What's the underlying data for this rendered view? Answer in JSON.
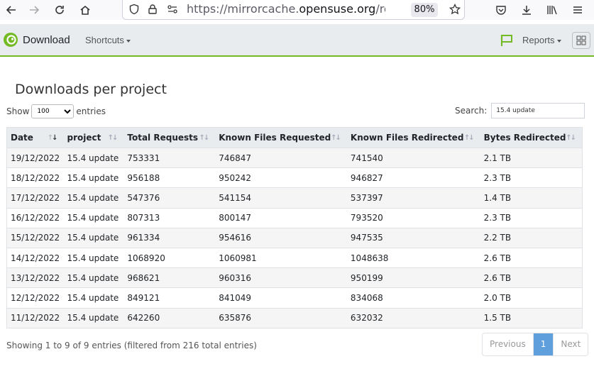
{
  "browser": {
    "url_prefix": "https://mirrorcache.",
    "url_domain": "opensuse.org",
    "url_suffix": "/report/dow",
    "zoom": "80%"
  },
  "header": {
    "brand": "Download",
    "shortcuts": "Shortcuts",
    "reports": "Reports"
  },
  "page": {
    "title": "Downloads per project",
    "show_label": "Show",
    "entries_label": "entries",
    "page_length": "100",
    "search_label": "Search:",
    "search_value": "15.4 update"
  },
  "table": {
    "columns": [
      "Date",
      "project",
      "Total Requests",
      "Known Files Requested",
      "Known Files Redirected",
      "Bytes Redirected"
    ],
    "rows": [
      [
        "19/12/2022",
        "15.4 update",
        "753331",
        "746847",
        "741540",
        "2.1 TB"
      ],
      [
        "18/12/2022",
        "15.4 update",
        "956188",
        "950242",
        "946827",
        "2.3 TB"
      ],
      [
        "17/12/2022",
        "15.4 update",
        "547376",
        "541154",
        "537397",
        "1.4 TB"
      ],
      [
        "16/12/2022",
        "15.4 update",
        "807313",
        "800147",
        "793520",
        "2.3 TB"
      ],
      [
        "15/12/2022",
        "15.4 update",
        "961334",
        "954616",
        "947535",
        "2.2 TB"
      ],
      [
        "14/12/2022",
        "15.4 update",
        "1068920",
        "1060981",
        "1048638",
        "2.6 TB"
      ],
      [
        "13/12/2022",
        "15.4 update",
        "968621",
        "960316",
        "950199",
        "2.6 TB"
      ],
      [
        "12/12/2022",
        "15.4 update",
        "849121",
        "841049",
        "834068",
        "2.0 TB"
      ],
      [
        "11/12/2022",
        "15.4 update",
        "642260",
        "635876",
        "632032",
        "1.5 TB"
      ]
    ]
  },
  "footer": {
    "info": "Showing 1 to 9 of 9 entries (filtered from 216 total entries)",
    "previous": "Previous",
    "current_page": "1",
    "next": "Next"
  },
  "colors": {
    "accent_green": "#73ba25",
    "page_active": "#5fa0dc"
  }
}
